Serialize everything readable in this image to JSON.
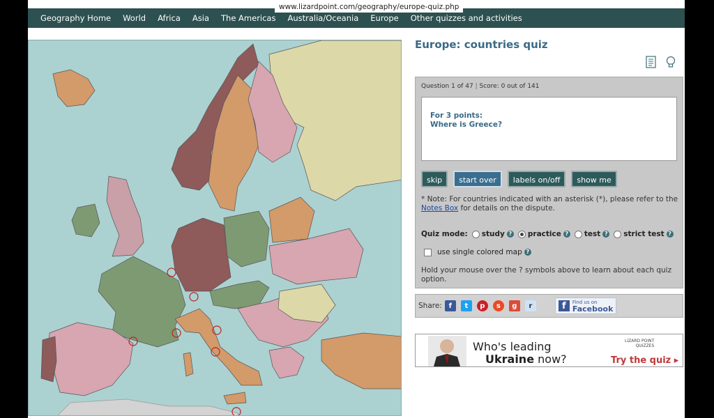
{
  "browser": {
    "url": "www.lizardpoint.com/geography/europe-quiz.php"
  },
  "nav": {
    "items": [
      "Geography Home",
      "World",
      "Africa",
      "Asia",
      "The Americas",
      "Australia/Oceania",
      "Europe",
      "Other quizzes and activities"
    ]
  },
  "quiz": {
    "title": "Europe: countries quiz",
    "question_counter": "Question 1 of 47",
    "separator": "|",
    "score": "Score: 0 out of 141",
    "prompt_points": "For 3 points:",
    "prompt_question": "Where is Greece?",
    "buttons": {
      "skip": "skip",
      "start_over": "start over",
      "labels": "labels on/off",
      "show_me": "show me"
    },
    "note_prefix": "* Note: For countries indicated with an asterisk (*), please refer to the",
    "note_link": "Notes Box",
    "note_suffix": "for details on the dispute.",
    "mode_label": "Quiz mode:",
    "modes": {
      "study": "study",
      "practice": "practice",
      "test": "test",
      "strict_test": "strict test"
    },
    "selected_mode": "practice",
    "help_glyph": "?",
    "single_color_label": "use single colored map",
    "hold_text": "Hold your mouse over the ? symbols above to learn about each quiz option."
  },
  "share": {
    "label": "Share:",
    "fb_small": "Find us on",
    "fb_big": "Facebook"
  },
  "ad": {
    "line1": "Who's leading",
    "line2_bold": "Ukraine",
    "line2_rest": "now?",
    "brand1": "LIZARD POINT",
    "brand2": "QUIZZES",
    "cta": "Try the quiz"
  },
  "colors": {
    "nav_bg": "#2d5050",
    "title": "#3a6a86",
    "button": "#2d5a5a",
    "sea": "#acd1d1"
  }
}
